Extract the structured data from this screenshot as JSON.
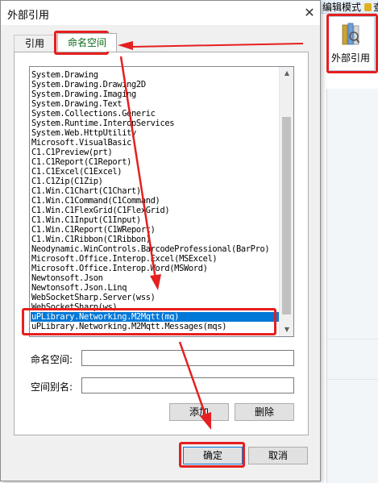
{
  "background_app": {
    "mode_text": "编辑模式",
    "query_text": "查",
    "ribbon_button_label": "外部引用",
    "left_strip_chars": [
      "目",
      "o",
      "c",
      "t",
      "t",
      "t",
      "t",
      "7",
      "t"
    ]
  },
  "dialog": {
    "title": "外部引用",
    "close_symbol": "✕",
    "tabs": [
      {
        "label": "引用",
        "active": false
      },
      {
        "label": "命名空间",
        "active": true
      }
    ],
    "namespaces": [
      "System.Drawing",
      "System.Drawing.Drawing2D",
      "System.Drawing.Imaging",
      "System.Drawing.Text",
      "System.Collections.Generic",
      "System.Runtime.InteropServices",
      "System.Web.HttpUtility",
      "Microsoft.VisualBasic",
      "C1.C1Preview(prt)",
      "C1.C1Report(C1Report)",
      "C1.C1Excel(C1Excel)",
      "C1.C1Zip(C1Zip)",
      "C1.Win.C1Chart(C1Chart)",
      "C1.Win.C1Command(C1Command)",
      "C1.Win.C1FlexGrid(C1FlexGrid)",
      "C1.Win.C1Input(C1Input)",
      "C1.Win.C1Report(C1WReport)",
      "C1.Win.C1Ribbon(C1Ribbon)",
      "Neodynamic.WinControls.BarcodeProfessional(BarPro)",
      "Microsoft.Office.Interop.Excel(MSExcel)",
      "Microsoft.Office.Interop.Word(MSWord)",
      "Newtonsoft.Json",
      "Newtonsoft.Json.Linq",
      "WebSocketSharp.Server(wss)",
      "WebSocketSharp(ws)",
      "uPLibrary.Networking.M2Mqtt(mq)",
      "uPLibrary.Networking.M2Mqtt.Messages(mqs)"
    ],
    "selected_index": 25,
    "scroll_up": "▲",
    "scroll_down": "▼",
    "namespace_label": "命名空间:",
    "namespace_value": "",
    "alias_label": "空间别名:",
    "alias_value": "",
    "add_button": "添加",
    "delete_button": "删除",
    "ok_button": "确定",
    "cancel_button": "取消"
  },
  "annotation_color": "#e52020"
}
